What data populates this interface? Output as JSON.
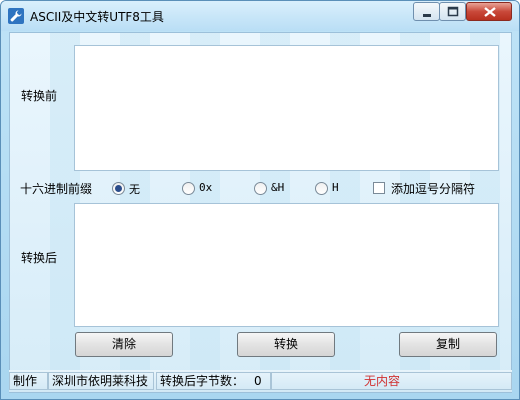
{
  "window": {
    "title": "ASCII及中文转UTF8工具",
    "icon": "wrench-icon"
  },
  "fields": {
    "before_label": "转换前",
    "after_label": "转换后",
    "before_value": "",
    "after_value": ""
  },
  "prefix": {
    "label": "十六进制前缀",
    "options": [
      "无",
      "0x",
      "&H",
      "H"
    ],
    "selected": "无",
    "comma_label": "添加逗号分隔符",
    "comma_checked": false
  },
  "buttons": {
    "clear": "清除",
    "convert": "转换",
    "copy": "复制"
  },
  "status": {
    "made_by_label": "制作",
    "company": "深圳市依明莱科技",
    "bytes_label": "转换后字节数：",
    "bytes_value": "0",
    "state": "无内容"
  },
  "colors": {
    "accent": "#2f74c0",
    "status_state": "#d03030"
  }
}
